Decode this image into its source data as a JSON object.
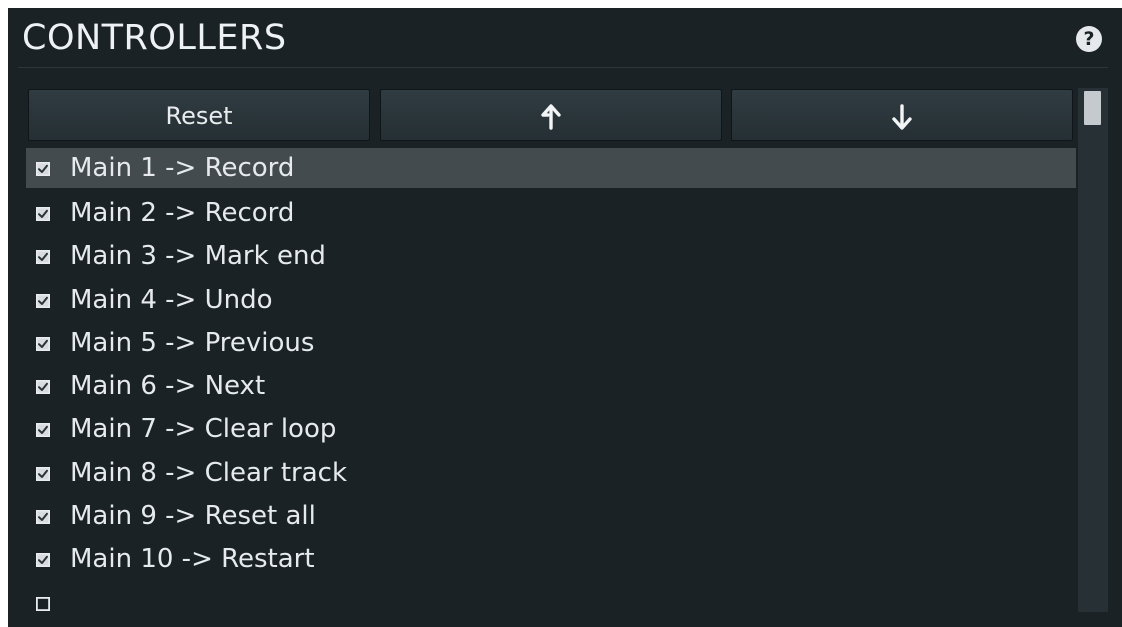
{
  "header": {
    "title": "CONTROLLERS",
    "help_label": "?"
  },
  "toolbar": {
    "reset_label": "Reset",
    "up_icon": "arrow-up-icon",
    "down_icon": "arrow-down-icon"
  },
  "list": {
    "items": [
      {
        "label": "Main 1 -> Record",
        "checked": true,
        "selected": true
      },
      {
        "label": "Main 2 -> Record",
        "checked": true
      },
      {
        "label": "Main 3 -> Mark end",
        "checked": true
      },
      {
        "label": "Main 4 -> Undo",
        "checked": true
      },
      {
        "label": "Main 5 -> Previous",
        "checked": true
      },
      {
        "label": "Main 6 -> Next",
        "checked": true
      },
      {
        "label": "Main 7 -> Clear loop",
        "checked": true
      },
      {
        "label": "Main 8 -> Clear track",
        "checked": true
      },
      {
        "label": "Main 9 -> Reset all",
        "checked": true
      },
      {
        "label": "Main 10 -> Restart",
        "checked": true
      },
      {
        "label": "",
        "checked": false
      }
    ]
  },
  "colors": {
    "panel_bg": "#1a2226",
    "selected_row": "#444b4f",
    "text": "#e6eaec"
  }
}
